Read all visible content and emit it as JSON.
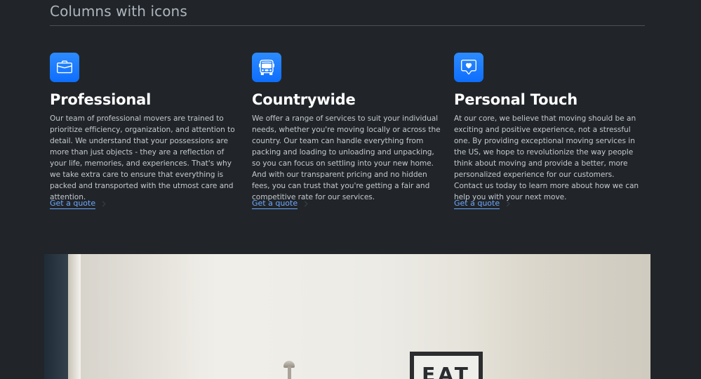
{
  "section": {
    "title": "Columns with icons"
  },
  "features": [
    {
      "icon": "briefcase-icon",
      "title": "Professional",
      "body": "Our team of professional movers are trained to prioritize efficiency, organization, and attention to detail. We understand that your possessions are more than just objects - they are a reflection of your life, memories, and experiences. That's why we take extra care to ensure that everything is packed and transported with the utmost care and attention.",
      "link_label": "Get a quote"
    },
    {
      "icon": "bus-icon",
      "title": "Countrywide",
      "body": "We offer a range of services to suit your individual needs, whether you're moving locally or across the country. Our team can handle everything from packing and loading to unloading and unpacking, so you can focus on settling into your new home. And with our transparent pricing and no hidden fees, you can trust that you're getting a fair and competitive rate for our services.",
      "link_label": "Get a quote"
    },
    {
      "icon": "chat-heart-icon",
      "title": "Personal Touch",
      "body": "At our core, we believe that moving should be an exciting and positive experience, not a stressful one. By providing exceptional moving services in the US, we hope to revolutionize the way people think about moving and provide a better, more personalized experience for our customers. Contact us today to learn more about how we can help you with your next move.",
      "link_label": "Get a quote"
    }
  ],
  "photo": {
    "sign_text": "EAT"
  },
  "colors": {
    "background": "#212529",
    "accent": "#0d6efd",
    "link": "#6ea8fe",
    "heading": "#ffffff",
    "body_text": "#c3c9cf"
  }
}
